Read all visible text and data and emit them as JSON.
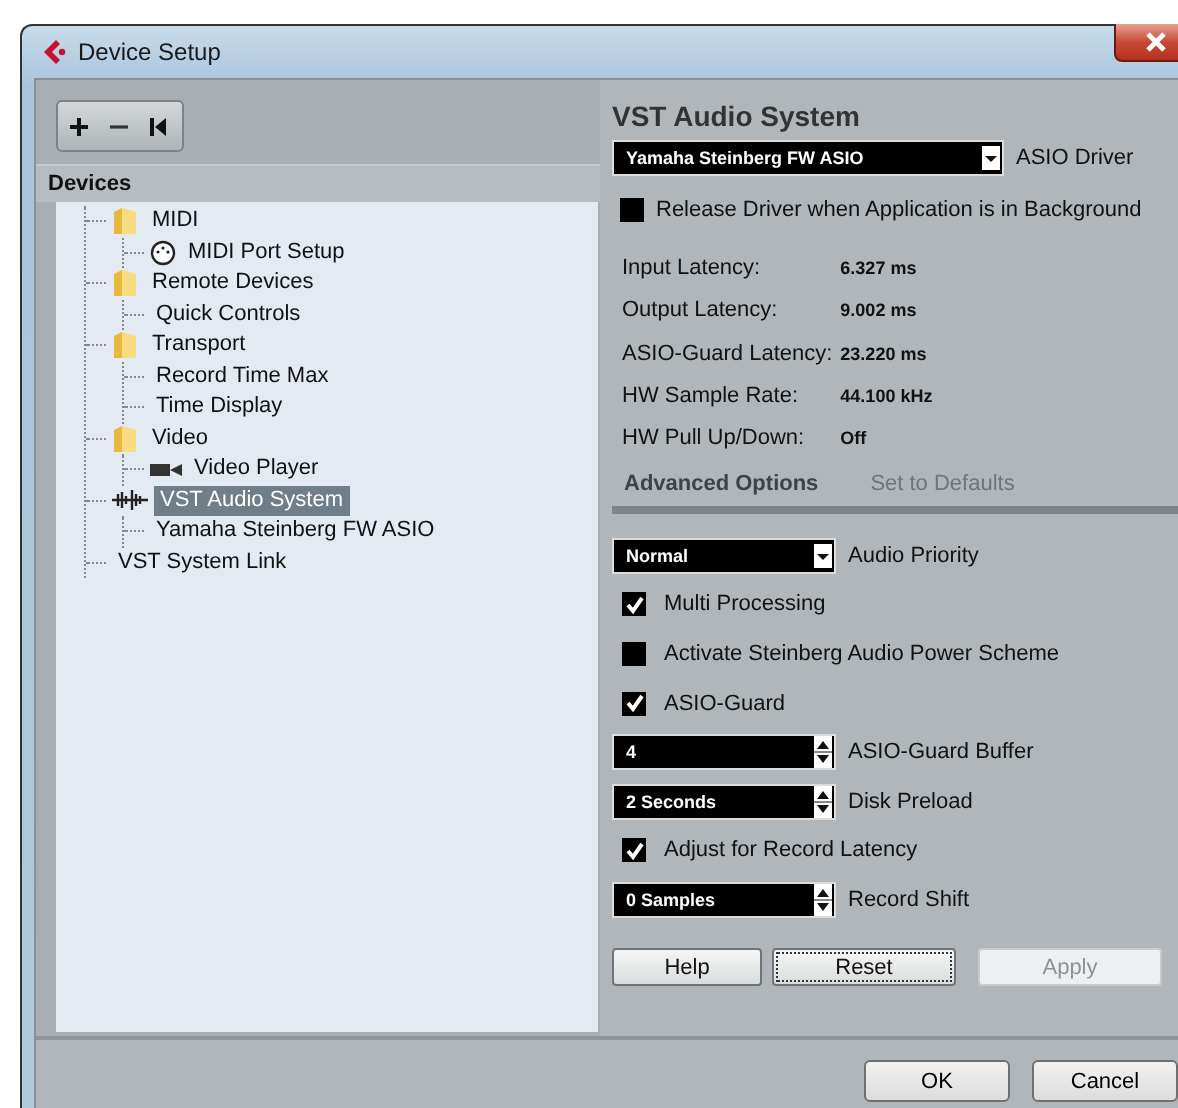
{
  "window": {
    "title": "Device Setup"
  },
  "toolbar": {
    "buttons": [
      {
        "kind": "add"
      },
      {
        "kind": "remove"
      },
      {
        "kind": "reset"
      }
    ]
  },
  "devices": {
    "header": "Devices",
    "items": [
      {
        "label": "MIDI",
        "kind": "folder",
        "selected": false,
        "children": [
          {
            "label": "MIDI Port Setup",
            "kind": "midi",
            "selected": false
          }
        ]
      },
      {
        "label": "Remote Devices",
        "kind": "folder",
        "selected": false,
        "children": [
          {
            "label": "Quick Controls",
            "kind": "plain",
            "selected": false
          }
        ]
      },
      {
        "label": "Transport",
        "kind": "folder",
        "selected": false,
        "children": [
          {
            "label": "Record Time Max",
            "kind": "plain",
            "selected": false
          },
          {
            "label": "Time Display",
            "kind": "plain",
            "selected": false
          }
        ]
      },
      {
        "label": "Video",
        "kind": "folder",
        "selected": false,
        "children": [
          {
            "label": "Video Player",
            "kind": "video",
            "selected": false
          }
        ]
      },
      {
        "label": "VST Audio System",
        "kind": "audio",
        "selected": true,
        "children": [
          {
            "label": "Yamaha Steinberg FW ASIO",
            "kind": "plain",
            "selected": false
          }
        ]
      },
      {
        "label": "VST System Link",
        "kind": "plain",
        "selected": false
      }
    ]
  },
  "panel": {
    "title": "VST Audio System",
    "driver": {
      "value": "Yamaha Steinberg FW ASIO",
      "label": "ASIO Driver"
    },
    "release_driver": {
      "label": "Release Driver when Application is in Background",
      "checked": false
    },
    "info": [
      {
        "label": "Input Latency:",
        "value": "6.327 ms"
      },
      {
        "label": "Output Latency:",
        "value": "9.002 ms"
      },
      {
        "label": "ASIO-Guard Latency:",
        "value": "23.220 ms"
      },
      {
        "label": "HW Sample Rate:",
        "value": "44.100 kHz"
      },
      {
        "label": "HW Pull Up/Down:",
        "value": "Off"
      }
    ],
    "tabs": [
      {
        "label": "Advanced Options",
        "selected": true
      },
      {
        "label": "Set to Defaults",
        "selected": false
      }
    ],
    "options": [
      {
        "kind": "dropdown",
        "label": "Audio Priority",
        "setting": "Normal"
      },
      {
        "kind": "checkbox",
        "label": "Multi Processing",
        "checked": true
      },
      {
        "kind": "checkbox",
        "label": "Activate Steinberg Audio Power Scheme",
        "checked": false
      },
      {
        "kind": "checkbox",
        "label": "ASIO-Guard",
        "checked": true
      },
      {
        "kind": "spinner",
        "label": "ASIO-Guard Buffer",
        "setting": "4"
      },
      {
        "kind": "spinner",
        "label": "Disk Preload",
        "setting": "2 Seconds"
      },
      {
        "kind": "checkbox",
        "label": "Adjust for Record Latency",
        "checked": true
      },
      {
        "kind": "spinner",
        "label": "Record Shift",
        "setting": "0 Samples"
      }
    ],
    "buttons": [
      {
        "label": "Help",
        "disabled": false,
        "focused": false
      },
      {
        "label": "Reset",
        "disabled": false,
        "focused": true
      },
      {
        "label": "Apply",
        "disabled": true,
        "focused": false
      }
    ]
  },
  "footer": {
    "buttons": [
      "OK",
      "Cancel"
    ]
  }
}
